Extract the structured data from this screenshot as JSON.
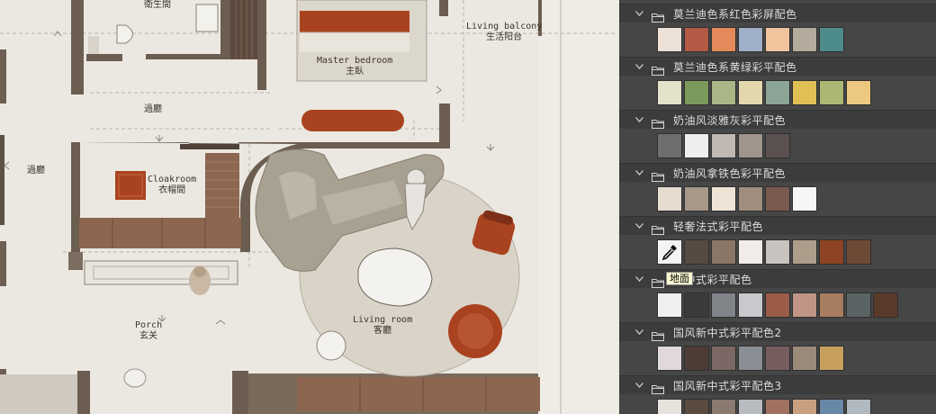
{
  "floorplan": {
    "rooms": [
      {
        "id": "bathroom",
        "en": "",
        "cn": "衛生間"
      },
      {
        "id": "master-bedroom",
        "en": "Master bedroom",
        "cn": "主臥"
      },
      {
        "id": "living-balcony",
        "en": "Living balcony",
        "cn": "生活阳台"
      },
      {
        "id": "corridor-1",
        "en": "",
        "cn": "過廳"
      },
      {
        "id": "corridor-2",
        "en": "",
        "cn": "過廳"
      },
      {
        "id": "cloakroom",
        "en": "Cloakroom",
        "cn": "衣帽間"
      },
      {
        "id": "porch",
        "en": "Porch",
        "cn": "玄关"
      },
      {
        "id": "living-room",
        "en": "Living room",
        "cn": "客廳"
      }
    ]
  },
  "swatches_panel": {
    "groups": [
      {
        "name": "莫兰迪色系红色彩屏配色",
        "colors": [
          "#ede0d6",
          "#b25a45",
          "#e28a5a",
          "#9fb0c8",
          "#f2c49e",
          "#b4ab9d",
          "#4e8b8b"
        ]
      },
      {
        "name": "莫兰迪色系黄绿彩平配色",
        "colors": [
          "#e3e2cb",
          "#7d9a5d",
          "#a9b786",
          "#e3d8ad",
          "#8ca597",
          "#e0bf55",
          "#adb774",
          "#ecc880"
        ]
      },
      {
        "name": "奶油风淡雅灰彩平配色",
        "colors": [
          "#6f6e6c",
          "#f0eeec",
          "#c0b8b2",
          "#a0948c",
          "#5b5150"
        ]
      },
      {
        "name": "奶油风拿铁色彩平配色",
        "colors": [
          "#e6ddd0",
          "#a79889",
          "#efe3d5",
          "#9f8e7f",
          "#7a5a4f",
          "#f6f6f4"
        ]
      },
      {
        "name": "轻奢法式彩平配色",
        "colors": [
          "#f4f4f4",
          "#574a40",
          "#8b7768",
          "#f1ecea",
          "#c8c3be",
          "#ad9e8c",
          "#8e4424",
          "#6c4a36"
        ]
      },
      {
        "name": "新中式彩平配色",
        "colors": [
          "#f0f0f0",
          "#3b3b3b",
          "#818489",
          "#c8c9cc",
          "#9b5c48",
          "#c09585",
          "#a87d5f",
          "#5b6464",
          "#5a3a2a"
        ]
      },
      {
        "name": "国风新中式彩平配色2",
        "colors": [
          "#e0d8da",
          "#4e3d36",
          "#7b6864",
          "#8a8f95",
          "#765e5f",
          "#9a8a7a",
          "#c8a05e"
        ]
      },
      {
        "name": "国风新中式彩平配色3",
        "colors": [
          "#e6e2dc",
          "#5a4a40",
          "#8a7a70",
          "#b8bcc0",
          "#a07060",
          "#c8a080",
          "#6888a8",
          "#b0b8c0"
        ]
      }
    ],
    "eyedropper_icon": "eyedropper-icon",
    "tooltip": "地面"
  }
}
